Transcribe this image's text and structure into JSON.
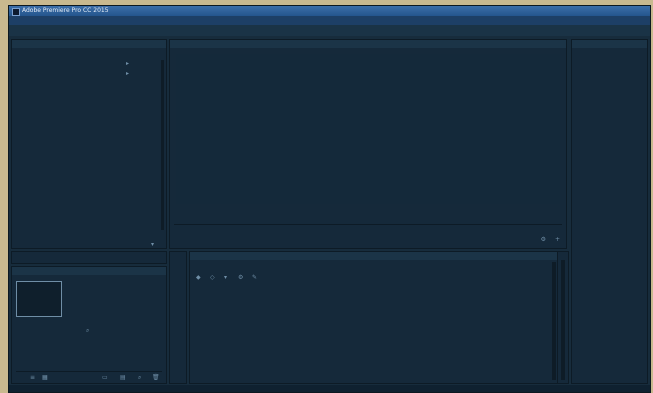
{
  "window": {
    "title": "Adobe Premiere Pro CC 2015",
    "controls": {
      "minimize": "",
      "maximize": "",
      "close": ""
    }
  },
  "menubar": {
    "items": [
      "",
      "",
      "",
      "",
      "",
      "",
      "",
      ""
    ]
  },
  "workspaces": {
    "items": [
      "",
      "",
      "",
      "",
      "",
      "",
      "",
      "",
      "",
      ""
    ]
  },
  "effect_controls_panel": {
    "tabs": [
      "",
      "",
      ""
    ],
    "clip_label": "",
    "footer_time": ""
  },
  "program_monitor": {
    "tab": "",
    "timecode_left": "",
    "timecode_right": "",
    "transport": [
      "",
      "",
      "",
      "",
      "",
      "",
      "",
      "",
      "",
      ""
    ]
  },
  "history_panel": {
    "tab": ""
  },
  "project_panel": {
    "tab": "",
    "file_name": "",
    "item_count": "",
    "bin_name": "",
    "status": "",
    "import_hint": ""
  },
  "tools_panel": {
    "tools": [
      "",
      "",
      "",
      "",
      "",
      "",
      "",
      "",
      "",
      ""
    ]
  },
  "timeline_panel": {
    "tab": "",
    "timecode": "",
    "empty_message": ""
  },
  "info_panel": {
    "tab": "",
    "items": [
      "",
      "",
      "",
      "",
      ""
    ]
  },
  "statusbar": {
    "text": ""
  },
  "colors": {
    "titlebar": "#24558d",
    "panel": "#15293a",
    "background": "#172c3c"
  }
}
